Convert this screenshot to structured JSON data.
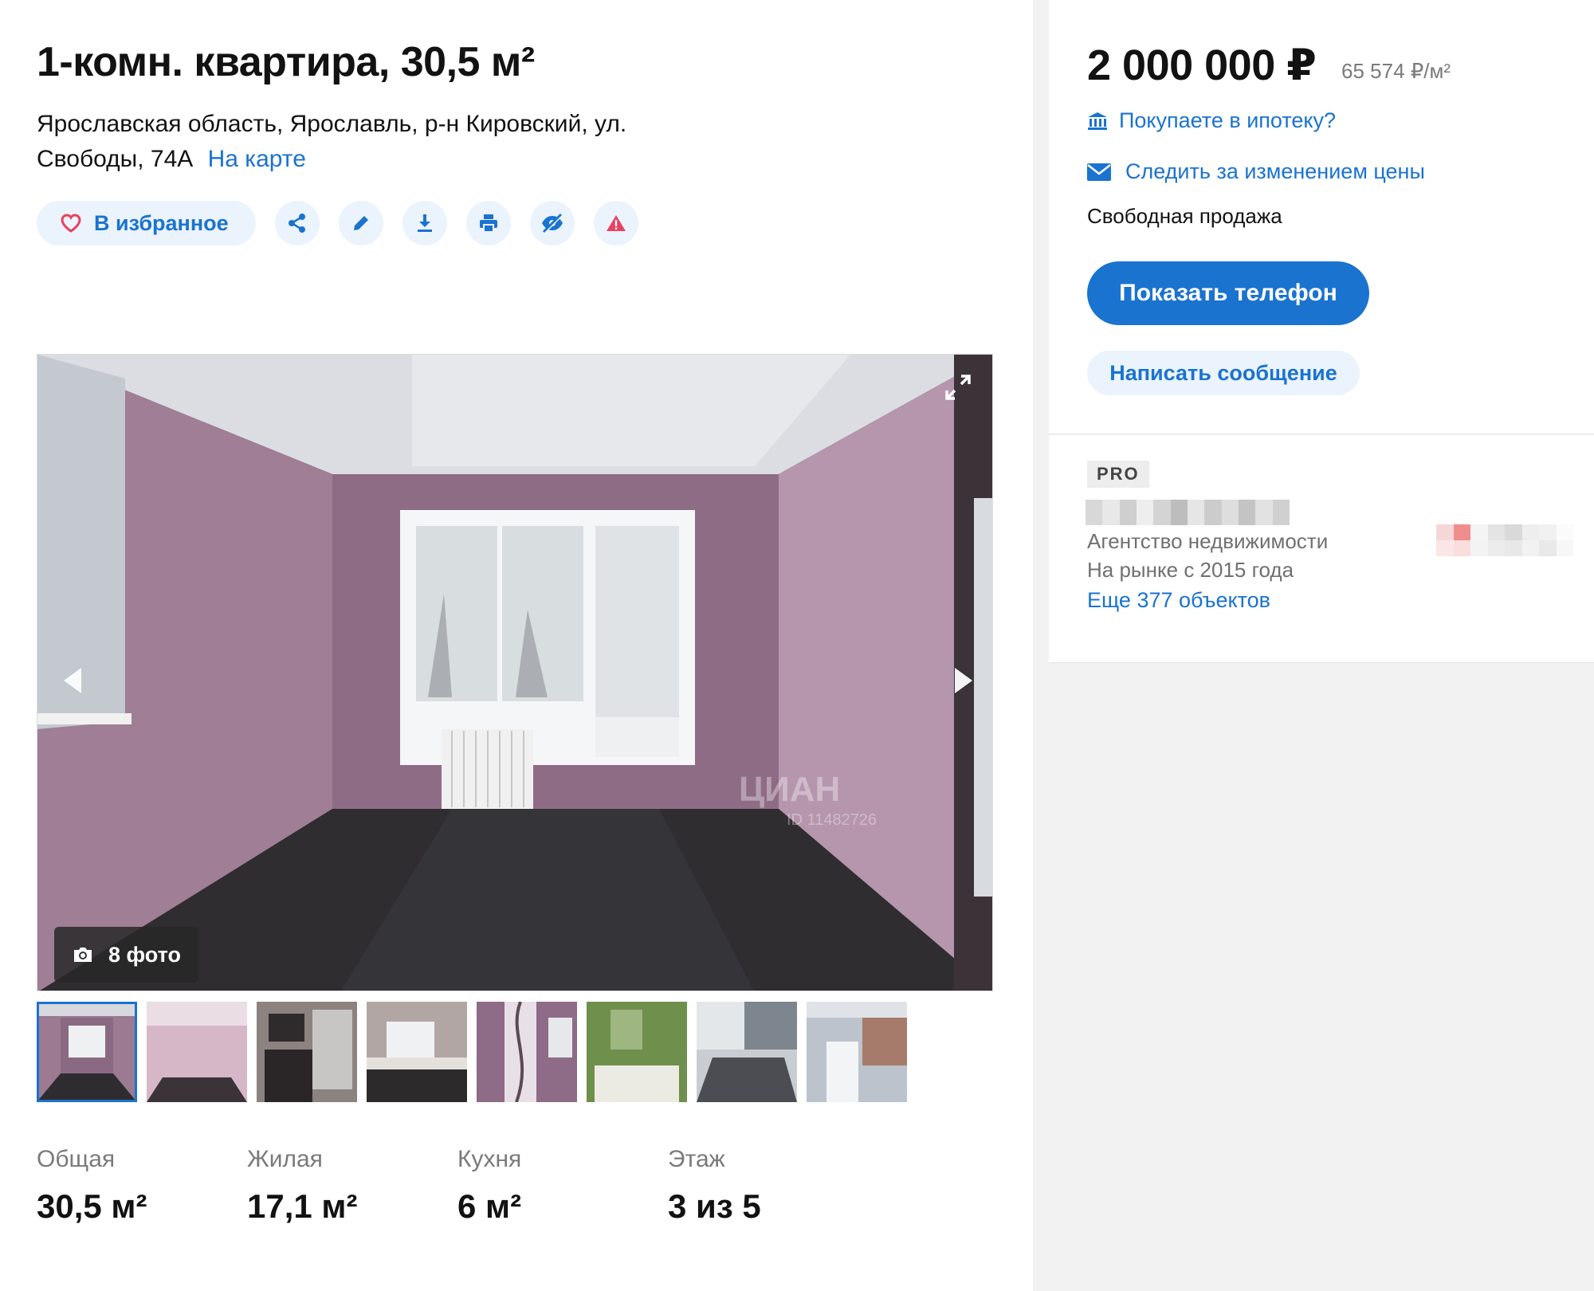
{
  "listing": {
    "title": "1-комн. квартира, 30,5 м²",
    "address": "Ярославская область, Ярославль, р-н Кировский, ул. Свободы, 74А",
    "map_link": "На карте"
  },
  "actions": {
    "favorite_label": "В избранное",
    "icons": [
      "share-icon",
      "edit-icon",
      "download-icon",
      "print-icon",
      "hide-icon",
      "complaint-icon"
    ]
  },
  "gallery": {
    "photo_count": "8 фото",
    "watermark_brand": "ЦИАН",
    "watermark_id": "ID 11482726",
    "thumbnails": 8,
    "active_thumbnail": 1
  },
  "facts": [
    {
      "label": "Общая",
      "value": "30,5 м²"
    },
    {
      "label": "Жилая",
      "value": "17,1 м²"
    },
    {
      "label": "Кухня",
      "value": "6 м²"
    },
    {
      "label": "Этаж",
      "value": "3 из 5"
    }
  ],
  "sidebar": {
    "price": "2 000 000 ₽",
    "price_per_meter": "65 574 ₽/м²",
    "mortgage_link": "Покупаете в ипотеку?",
    "watch_price_link": "Следить за изменением цены",
    "sale_type": "Свободная продажа",
    "phone_button": "Показать телефон",
    "message_button": "Написать сообщение"
  },
  "agent": {
    "badge": "PRO",
    "type": "Агентство недвижимости",
    "since": "На рынке с 2015 года",
    "more_objects": "Еще 377 объектов"
  },
  "colors": {
    "accent": "#1a73cf",
    "accent_light": "#ebf3fd",
    "favorite_heart": "#e84260",
    "complaint": "#e84260"
  }
}
